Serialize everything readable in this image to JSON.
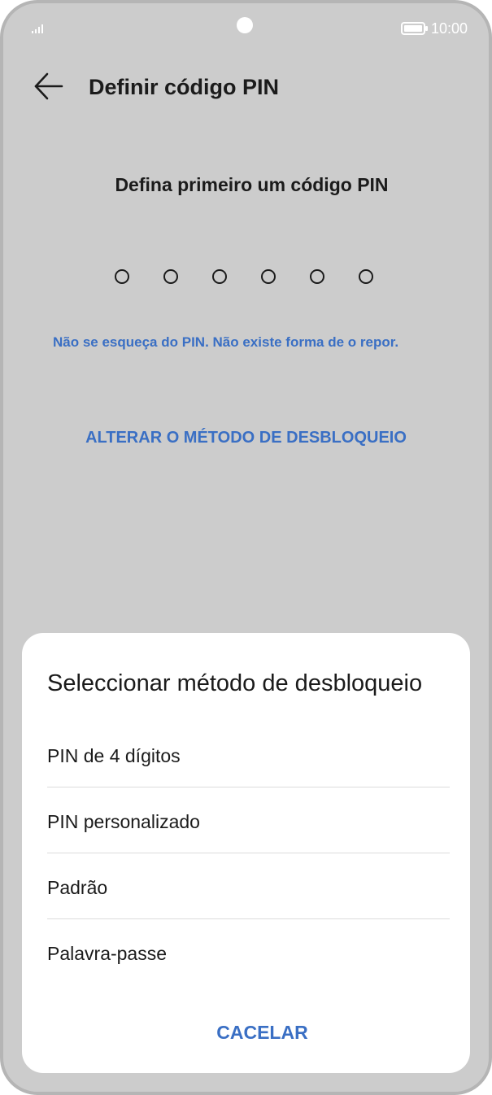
{
  "status_bar": {
    "time": "10:00",
    "icons": [
      "signal-icon",
      "camera-cutout",
      "battery-icon"
    ]
  },
  "header": {
    "back_icon": "arrow-left-icon",
    "title": "Definir código PIN"
  },
  "pin_entry": {
    "prompt": "Defina primeiro um código PIN",
    "digit_count": 6,
    "filled": 0,
    "warning": "Não se esqueça do PIN. Não existe forma de o repor.",
    "change_method_label": "ALTERAR O MÉTODO DE DESBLOQUEIO"
  },
  "sheet": {
    "title": "Seleccionar método de desbloqueio",
    "options": [
      {
        "label": "PIN de 4 dígitos"
      },
      {
        "label": "PIN personalizado"
      },
      {
        "label": "Padrão"
      },
      {
        "label": "Palavra-passe"
      }
    ],
    "cancel_label": "CACELAR"
  },
  "colors": {
    "background": "#cccccc",
    "text": "#1b1b1b",
    "accent": "#3a6fc4",
    "sheet": "#ffffff"
  }
}
